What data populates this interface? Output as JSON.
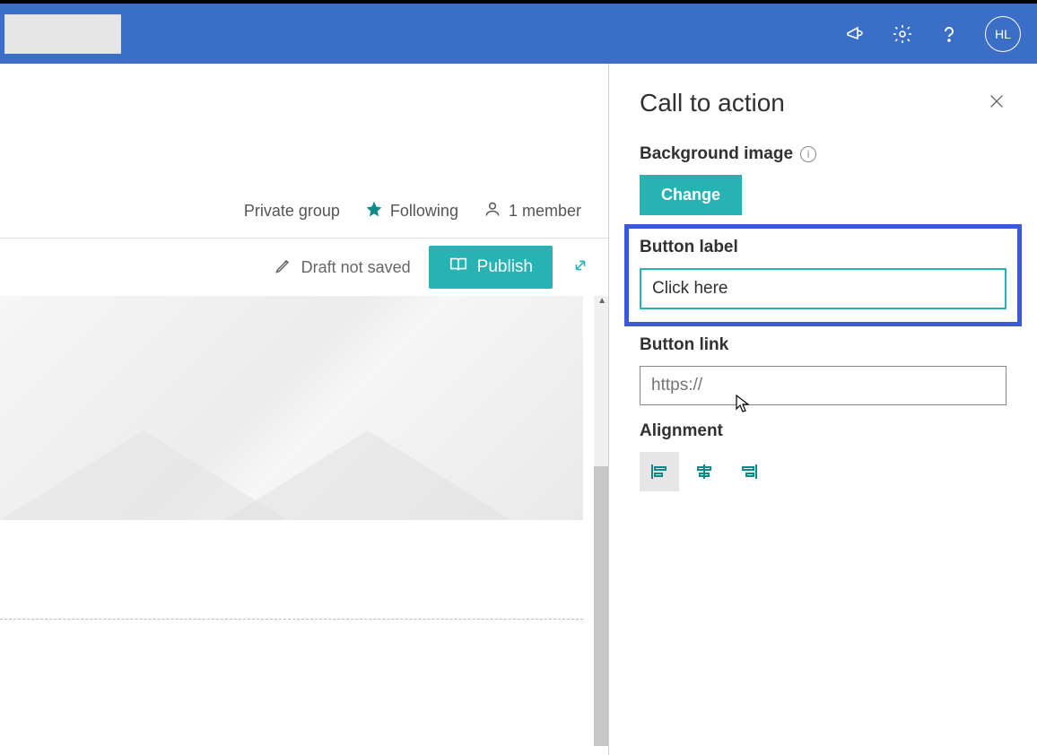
{
  "header": {
    "avatar_initials": "HL"
  },
  "meta": {
    "group_type": "Private group",
    "following_label": "Following",
    "member_count": "1 member"
  },
  "toolbar": {
    "draft_status": "Draft not saved",
    "publish_label": "Publish"
  },
  "panel": {
    "title": "Call to action",
    "background_image_label": "Background image",
    "change_label": "Change",
    "button_label_label": "Button label",
    "button_label_value": "Click here",
    "button_link_label": "Button link",
    "button_link_placeholder": "https://",
    "alignment_label": "Alignment"
  }
}
